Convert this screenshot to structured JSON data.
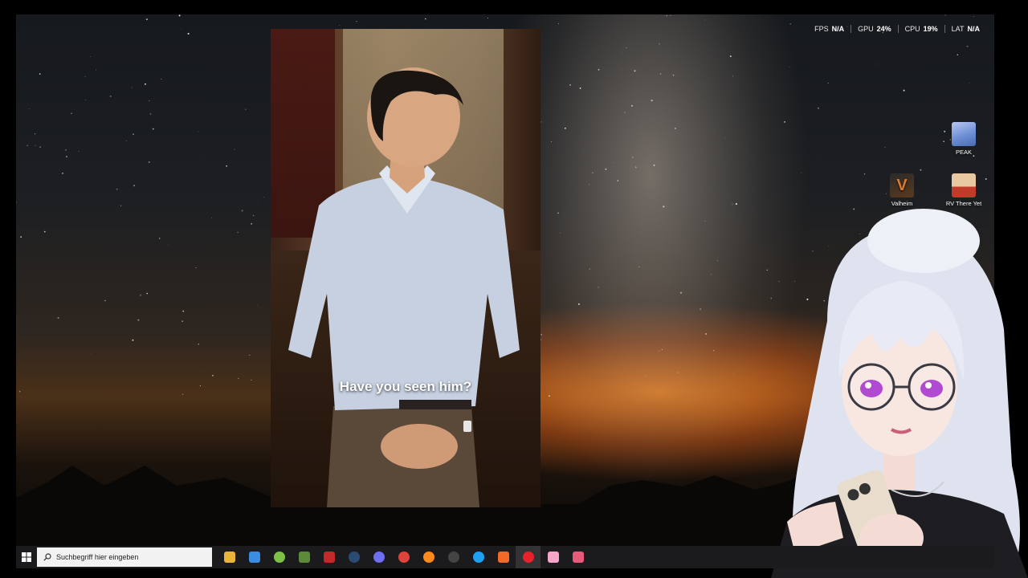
{
  "overlay": {
    "fps_label": "FPS",
    "fps_value": "N/A",
    "gpu_label": "GPU",
    "gpu_value": "24%",
    "cpu_label": "CPU",
    "cpu_value": "19%",
    "lat_label": "LAT",
    "lat_value": "N/A"
  },
  "video": {
    "subtitle": "Have you seen him?"
  },
  "desktop_icons": [
    {
      "label": "PEAK",
      "icon": "peak-app-icon",
      "color": "#6e8fd6"
    },
    {
      "label": "Valheim",
      "icon": "valheim-app-icon",
      "color": "#5a3a20"
    },
    {
      "label": "RV There Yet",
      "icon": "rv-there-yet-app-icon",
      "color": "#c23a2a"
    }
  ],
  "taskbar": {
    "search_placeholder": "Suchbegriff hier eingeben",
    "apps": [
      {
        "name": "file-explorer-icon",
        "color": "#e8b53a"
      },
      {
        "name": "store-icon",
        "color": "#3a8de0"
      },
      {
        "name": "android-icon",
        "color": "#7cc045"
      },
      {
        "name": "minecraft-icon",
        "color": "#5a8a3a"
      },
      {
        "name": "game-launcher-icon",
        "color": "#c22a2a"
      },
      {
        "name": "steam-icon",
        "color": "#2a4b72"
      },
      {
        "name": "discord-icon",
        "color": "#6d6ff0"
      },
      {
        "name": "chrome-icon",
        "color": "#e0433a"
      },
      {
        "name": "firefox-icon",
        "color": "#ff8a1a"
      },
      {
        "name": "obs-icon",
        "color": "#444444"
      },
      {
        "name": "battle-net-icon",
        "color": "#1da1f2"
      },
      {
        "name": "brave-icon",
        "color": "#f26a2a"
      },
      {
        "name": "opera-icon",
        "color": "#e8222a"
      },
      {
        "name": "pink-app-icon",
        "color": "#f5a6c8"
      },
      {
        "name": "tool-icon",
        "color": "#e85a7a"
      }
    ]
  },
  "colors": {
    "taskbar": "#1b1b1d",
    "accent": "#ff8a1a"
  }
}
